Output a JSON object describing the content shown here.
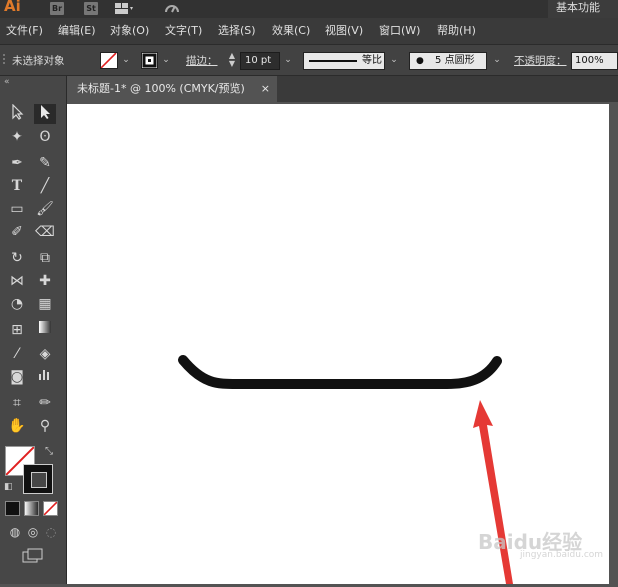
{
  "app": {
    "logo": "Ai",
    "bridge": "Br",
    "stock": "St",
    "workspace": "基本功能"
  },
  "menu": [
    "文件(F)",
    "编辑(E)",
    "对象(O)",
    "文字(T)",
    "选择(S)",
    "效果(C)",
    "视图(V)",
    "窗口(W)",
    "帮助(H)"
  ],
  "control": {
    "selection_status": "未选择对象",
    "stroke_label": "描边：",
    "stroke_weight": "10 pt",
    "profile_label": "等比",
    "brush_label": "5 点圆形",
    "opacity_label": "不透明度：",
    "opacity_value": "100%"
  },
  "document": {
    "tab_title": "未标题-1* @ 100% (CMYK/预览)",
    "close": "×"
  },
  "colors": {
    "stroke": "#111111",
    "arrow": "#e53935",
    "accent": "#e07a2a"
  },
  "watermark": {
    "brand": "Baidu经验",
    "url": "jingyan.baidu.com"
  }
}
